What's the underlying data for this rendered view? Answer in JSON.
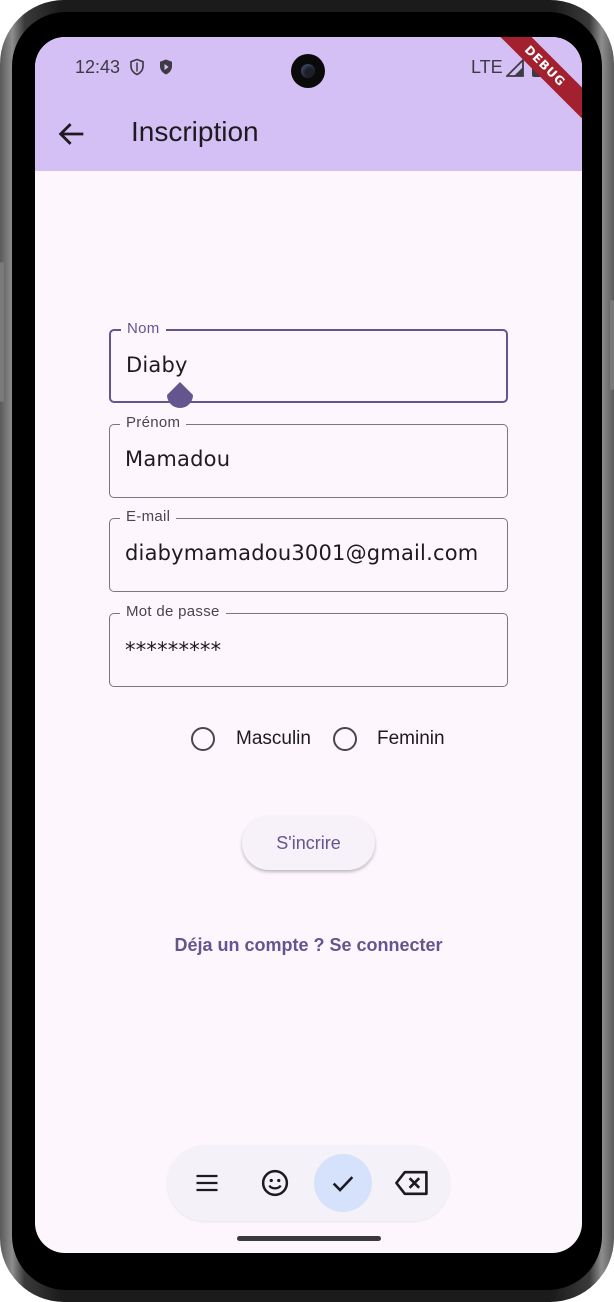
{
  "status_bar": {
    "time": "12:43",
    "network": "LTE"
  },
  "debug_banner": "DEBUG",
  "app_bar": {
    "title": "Inscription",
    "back_icon": "arrow-back-icon"
  },
  "form": {
    "nom": {
      "label": "Nom",
      "value": "Diaby"
    },
    "prenom": {
      "label": "Prénom",
      "value": "Mamadou"
    },
    "email": {
      "label": "E-mail",
      "value": "diabymamadou3001@gmail.com"
    },
    "password": {
      "label": "Mot de passe",
      "value": "*********"
    }
  },
  "gender": {
    "options": [
      {
        "label": "Masculin",
        "selected": false
      },
      {
        "label": "Feminin",
        "selected": false
      }
    ]
  },
  "submit_label": "S'incrire",
  "login_link": "Déja un compte ? Se connecter",
  "keyboard_toolbar": {
    "icons": [
      "menu-icon",
      "emoji-icon",
      "check-icon",
      "backspace-icon"
    ]
  },
  "colors": {
    "appbar": "#d4c0f4",
    "primary": "#65558f",
    "surface": "#fdf7fd"
  }
}
